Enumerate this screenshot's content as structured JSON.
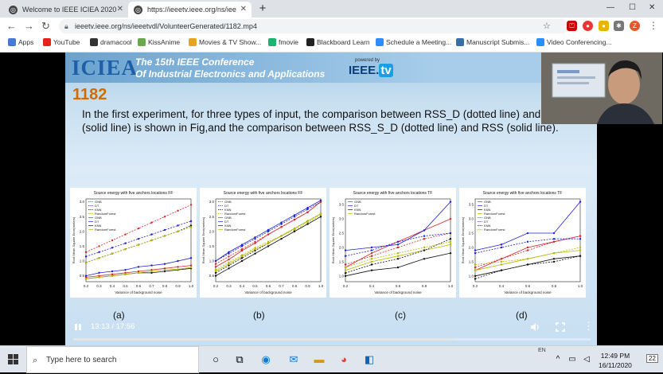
{
  "browser": {
    "tabs": [
      {
        "title": "Welcome to IEEE ICIEA 2020"
      },
      {
        "title": "https://ieeetv.ieee.org/ns/iee"
      }
    ],
    "new_tab_label": "+",
    "url": "ieeetv.ieee.org/ns/ieeetvdl/VolunteerGenerated/1182.mp4",
    "profile_initial": "Z",
    "bookmarks": [
      {
        "label": "Apps",
        "color": "#4a79d4"
      },
      {
        "label": "YouTube",
        "color": "#e62117"
      },
      {
        "label": "dramacool",
        "color": "#333"
      },
      {
        "label": "KissAnime",
        "color": "#6aa84f"
      },
      {
        "label": "Movies & TV Show...",
        "color": "#e7a41f"
      },
      {
        "label": "fmovie",
        "color": "#1db36e"
      },
      {
        "label": "Blackboard Learn",
        "color": "#222"
      },
      {
        "label": "Schedule a Meeting...",
        "color": "#2d8cff"
      },
      {
        "label": "Manuscript Submis...",
        "color": "#3a6ea8"
      },
      {
        "label": "Video Conferencing...",
        "color": "#2d8cff"
      }
    ]
  },
  "slide": {
    "logo": "ICIEA",
    "conference_line1": "The 15th IEEE Conference",
    "conference_line2": "Of Industrial Electronics and Applications",
    "powered_by": "powered by",
    "ieeetv_left": "IEEE.",
    "ieeetv_right": "tv",
    "paper_number": "1182",
    "body": "In the first experiment, for three types of input, the comparison between RSS_D (dotted line) and RSS (solid line) is shown in Fig,and the comparison between RSS_S_D (dotted line) and RSS (solid line).",
    "captions": [
      "(a)",
      "(b)",
      "(c)",
      "(d)"
    ]
  },
  "video": {
    "current_time": "13:13",
    "duration": "17:56",
    "time_display": "13:13 / 17:56",
    "progress": 0.737
  },
  "taskbar": {
    "search_placeholder": "Type here to search",
    "time": "12:49 PM",
    "date": "16/11/2020",
    "language": "EN",
    "notification_count": "22"
  },
  "chart_data": [
    {
      "type": "line",
      "title": "Source energy  with five anchors locations FF",
      "xlabel": "Variance of background noise",
      "ylabel": "Root Mean Square Error(meters)",
      "x": [
        0.2,
        0.3,
        0.4,
        0.5,
        0.6,
        0.7,
        0.8,
        0.9,
        1.0
      ],
      "ylim": [
        0.3,
        3.1
      ],
      "legend": [
        "GNB",
        "DT",
        "KNN",
        "RandomForest",
        "GNB",
        "DT",
        "KNN",
        "RandomForest"
      ],
      "series": [
        {
          "name": "GNB",
          "color": "#d62728",
          "style": "dashed",
          "values": [
            1.3,
            1.5,
            1.7,
            1.9,
            2.1,
            2.3,
            2.5,
            2.7,
            2.9
          ]
        },
        {
          "name": "DT",
          "color": "#1f1fd6",
          "style": "dashed",
          "values": [
            1.15,
            1.3,
            1.45,
            1.6,
            1.75,
            1.9,
            2.05,
            2.2,
            2.35
          ]
        },
        {
          "name": "KNN",
          "color": "#111111",
          "style": "dashed",
          "values": [
            0.95,
            1.1,
            1.25,
            1.4,
            1.55,
            1.7,
            1.85,
            2.0,
            2.2
          ]
        },
        {
          "name": "RandomForest",
          "color": "#b5b800",
          "style": "dashed",
          "values": [
            0.95,
            1.1,
            1.25,
            1.4,
            1.55,
            1.7,
            1.85,
            2.0,
            2.15
          ]
        },
        {
          "name": "GNB",
          "color": "#d62728",
          "style": "solid",
          "values": [
            0.45,
            0.5,
            0.55,
            0.6,
            0.65,
            0.7,
            0.75,
            0.8,
            0.85
          ]
        },
        {
          "name": "DT",
          "color": "#1f1fd6",
          "style": "solid",
          "values": [
            0.5,
            0.6,
            0.65,
            0.7,
            0.8,
            0.85,
            0.9,
            1.0,
            1.1
          ]
        },
        {
          "name": "KNN",
          "color": "#111111",
          "style": "solid",
          "values": [
            0.4,
            0.45,
            0.5,
            0.55,
            0.6,
            0.6,
            0.65,
            0.7,
            0.75
          ]
        },
        {
          "name": "RandomForest",
          "color": "#b5b800",
          "style": "solid",
          "values": [
            0.4,
            0.45,
            0.5,
            0.55,
            0.6,
            0.65,
            0.7,
            0.72,
            0.78
          ]
        }
      ]
    },
    {
      "type": "line",
      "title": "Source energy  with five anchors locations FF",
      "xlabel": "Variance of background noise",
      "ylabel": "Root Mean Square Error(meters)",
      "x": [
        0.2,
        0.3,
        0.4,
        0.5,
        0.6,
        0.7,
        0.8,
        0.9,
        1.0
      ],
      "ylim": [
        0.3,
        3.1
      ],
      "legend": [
        "GNB",
        "DT",
        "KNN",
        "RandomForest",
        "GNB",
        "DT",
        "KNN",
        "RandomForest"
      ],
      "series": [
        {
          "name": "GNB",
          "color": "#d62728",
          "style": "dashed",
          "values": [
            0.9,
            1.15,
            1.4,
            1.65,
            1.9,
            2.15,
            2.4,
            2.65,
            3.0
          ]
        },
        {
          "name": "DT",
          "color": "#1f1fd6",
          "style": "dashed",
          "values": [
            1.0,
            1.25,
            1.5,
            1.75,
            2.0,
            2.25,
            2.5,
            2.75,
            3.0
          ]
        },
        {
          "name": "KNN",
          "color": "#111111",
          "style": "dashed",
          "values": [
            0.6,
            0.85,
            1.1,
            1.35,
            1.6,
            1.85,
            2.1,
            2.35,
            2.6
          ]
        },
        {
          "name": "RandomForest",
          "color": "#b5b800",
          "style": "dashed",
          "values": [
            0.7,
            0.95,
            1.2,
            1.45,
            1.65,
            1.85,
            2.05,
            2.3,
            2.55
          ]
        },
        {
          "name": "GNB",
          "color": "#d62728",
          "style": "solid",
          "values": [
            0.8,
            1.05,
            1.35,
            1.6,
            1.9,
            2.15,
            2.4,
            2.65,
            3.0
          ]
        },
        {
          "name": "DT",
          "color": "#1f1fd6",
          "style": "solid",
          "values": [
            1.0,
            1.3,
            1.55,
            1.8,
            2.05,
            2.3,
            2.55,
            2.8,
            3.05
          ]
        },
        {
          "name": "KNN",
          "color": "#111111",
          "style": "solid",
          "values": [
            0.5,
            0.75,
            1.0,
            1.25,
            1.5,
            1.75,
            2.0,
            2.25,
            2.5
          ]
        },
        {
          "name": "RandomForest",
          "color": "#b5b800",
          "style": "solid",
          "values": [
            0.65,
            0.9,
            1.15,
            1.4,
            1.6,
            1.85,
            2.1,
            2.35,
            2.6
          ]
        }
      ]
    },
    {
      "type": "line",
      "title": "Source energy  with five anchors locations TF",
      "xlabel": "Variance of background noise",
      "ylabel": "Root Mean Square Error(meters)",
      "x": [
        0.2,
        0.4,
        0.6,
        0.8,
        1.0
      ],
      "ylim": [
        0.8,
        3.7
      ],
      "legend": [
        "GNB",
        "DT",
        "KNN",
        "RandomForest"
      ],
      "series": [
        {
          "name": "GNB",
          "color": "#d62728",
          "style": "solid",
          "values": [
            1.3,
            1.8,
            2.2,
            2.6,
            3.0
          ]
        },
        {
          "name": "DT",
          "color": "#1f1fd6",
          "style": "solid",
          "values": [
            1.9,
            2.0,
            2.1,
            2.6,
            3.6
          ]
        },
        {
          "name": "KNN",
          "color": "#111111",
          "style": "solid",
          "values": [
            1.0,
            1.2,
            1.3,
            1.6,
            1.8
          ]
        },
        {
          "name": "RandomForest",
          "color": "#b5b800",
          "style": "solid",
          "values": [
            1.2,
            1.5,
            1.7,
            1.9,
            2.1
          ]
        },
        {
          "name": "GNB",
          "color": "#d62728",
          "style": "dashed",
          "values": [
            1.4,
            1.7,
            2.0,
            2.3,
            2.5
          ]
        },
        {
          "name": "DT",
          "color": "#1f1fd6",
          "style": "dashed",
          "values": [
            1.7,
            1.9,
            2.2,
            2.4,
            2.5
          ]
        },
        {
          "name": "KNN",
          "color": "#111111",
          "style": "dashed",
          "values": [
            1.1,
            1.4,
            1.6,
            1.9,
            2.3
          ]
        },
        {
          "name": "RandomForest",
          "color": "#b5b800",
          "style": "dashed",
          "values": [
            1.3,
            1.6,
            1.8,
            2.0,
            2.2
          ]
        }
      ]
    },
    {
      "type": "line",
      "title": "Source energy  with five anchors locations TF",
      "xlabel": "Variance of background noise",
      "ylabel": "Root Mean Square Error(meters)",
      "x": [
        0.2,
        0.4,
        0.6,
        0.8,
        1.0
      ],
      "ylim": [
        0.8,
        3.7
      ],
      "legend": [
        "GNB",
        "DT",
        "KNN",
        "RandomForest",
        "GNB",
        "DT",
        "KNN",
        "RandomForest"
      ],
      "series": [
        {
          "name": "GNB",
          "color": "#d62728",
          "style": "solid",
          "values": [
            1.2,
            1.6,
            2.0,
            2.2,
            2.4
          ]
        },
        {
          "name": "DT",
          "color": "#1f1fd6",
          "style": "solid",
          "values": [
            1.9,
            2.1,
            2.5,
            2.5,
            3.6
          ]
        },
        {
          "name": "KNN",
          "color": "#111111",
          "style": "solid",
          "values": [
            1.0,
            1.2,
            1.4,
            1.6,
            1.7
          ]
        },
        {
          "name": "RandomForest",
          "color": "#b5b800",
          "style": "solid",
          "values": [
            1.2,
            1.4,
            1.6,
            1.8,
            1.9
          ]
        },
        {
          "name": "GNB",
          "color": "#d62728",
          "style": "dashed",
          "values": [
            1.3,
            1.6,
            1.9,
            2.2,
            2.4
          ]
        },
        {
          "name": "DT",
          "color": "#1f1fd6",
          "style": "dashed",
          "values": [
            1.8,
            2.0,
            2.2,
            2.3,
            2.3
          ]
        },
        {
          "name": "KNN",
          "color": "#111111",
          "style": "dashed",
          "values": [
            0.9,
            1.2,
            1.4,
            1.5,
            1.7
          ]
        },
        {
          "name": "RandomForest",
          "color": "#b5b800",
          "style": "dashed",
          "values": [
            1.4,
            1.5,
            1.6,
            1.8,
            2.0
          ]
        }
      ]
    }
  ]
}
